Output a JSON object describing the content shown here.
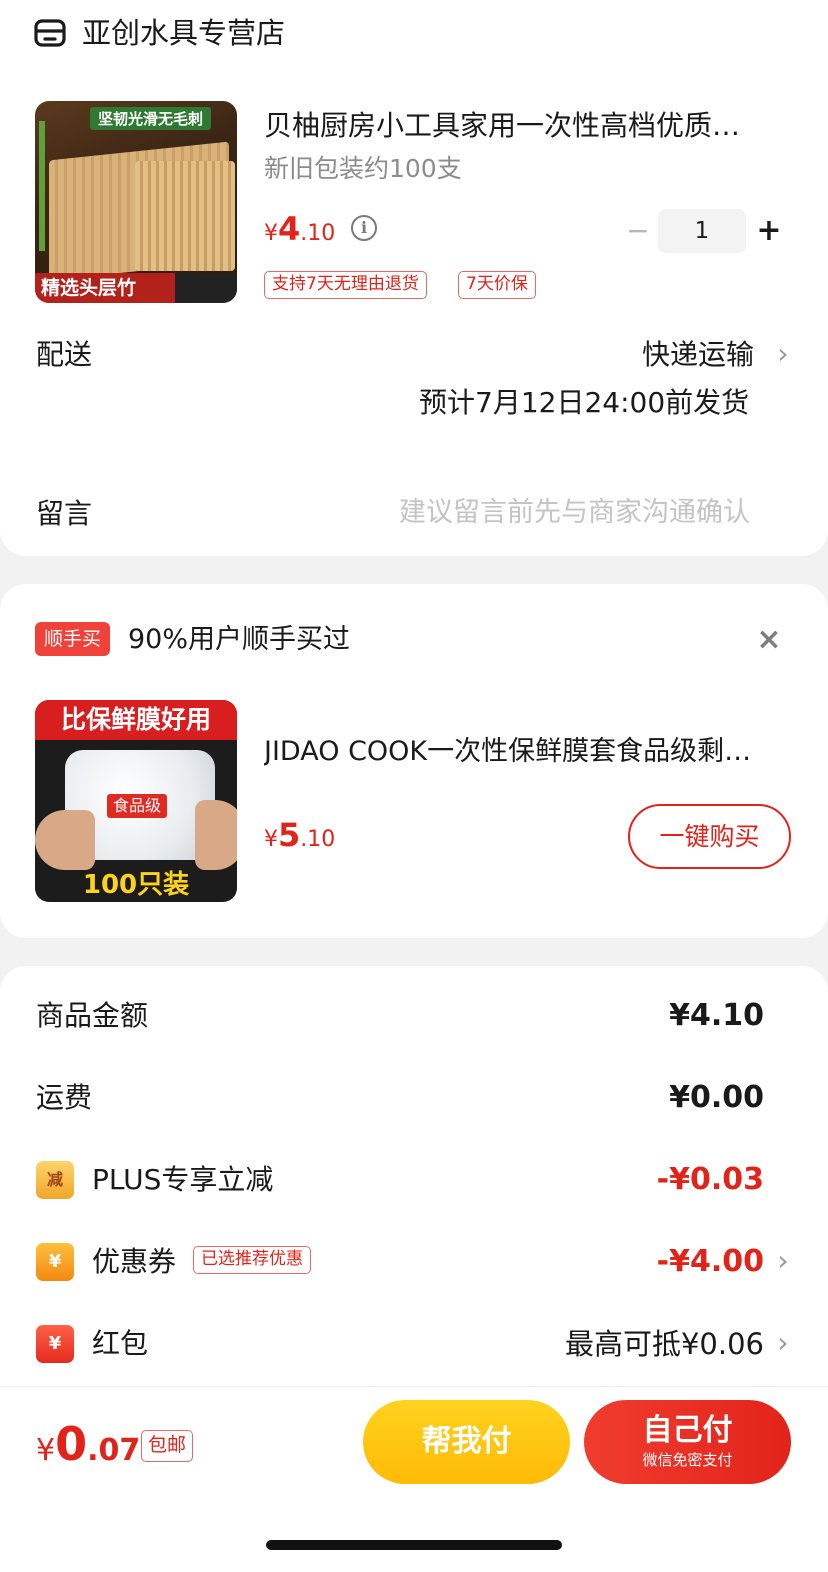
{
  "store": {
    "name": "亚创水具专营店",
    "icon": "store-icon"
  },
  "product": {
    "title": "贝柚厨房小工具家用一次性高档优质…",
    "spec": "新旧包装约100支",
    "price_symbol": "¥",
    "price_int": "4",
    "price_dec": ".10",
    "image_top_text": "坚韧光滑无毛刺",
    "image_bottom_text": "精选头层竹",
    "quantity": "1",
    "qty_minus": "−",
    "qty_plus": "+",
    "tags": [
      "支持7天无理由退货",
      "7天价保"
    ]
  },
  "delivery": {
    "label": "配送",
    "method": "快递运输",
    "eta": "预计7月12日24:00前发货"
  },
  "message": {
    "label": "留言",
    "placeholder": "建议留言前先与商家沟通确认"
  },
  "addon": {
    "badge": "顺手买",
    "title": "90%用户顺手买过",
    "close": "×",
    "product_title": "JIDAO COOK一次性保鲜膜套食品级剩…",
    "price_symbol": "¥",
    "price_int": "5",
    "price_dec": ".10",
    "image_header": "比保鲜膜好用",
    "image_label": "食品级",
    "image_footer": "100只装",
    "buy_button": "一键购买"
  },
  "summary": {
    "goods_label": "商品金额",
    "goods_value": "¥4.10",
    "shipping_label": "运费",
    "shipping_value": "¥0.00",
    "plus_icon_text": "减",
    "plus_label": "PLUS专享立减",
    "plus_value": "-¥0.03",
    "coupon_icon_text": "¥",
    "coupon_label": "优惠券",
    "coupon_tag": "已选推荐优惠",
    "coupon_value": "-¥4.00",
    "redpacket_icon_text": "¥",
    "redpacket_label": "红包",
    "redpacket_value": "最高可抵¥0.06",
    "chevron": "›"
  },
  "footer": {
    "total_symbol": "¥",
    "total_int": "0",
    "total_dec": ".07",
    "free_shipping": "包邮",
    "help_pay": "帮我付",
    "self_pay": "自己付",
    "self_pay_sub": "微信免密支付"
  },
  "colors": {
    "accent": "#e2231a",
    "yellow": "#ffc20e"
  }
}
